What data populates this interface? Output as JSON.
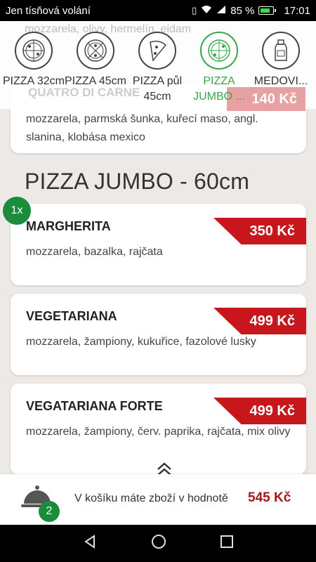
{
  "status_bar": {
    "carrier": "Jen tísňová volání",
    "battery": "85 %",
    "time": "17:01"
  },
  "categories": [
    {
      "label": "PIZZA 32cm",
      "icon": "pizza-icon",
      "active": false
    },
    {
      "label": "PIZZA 45cm",
      "icon": "pizza-icon",
      "active": false
    },
    {
      "label": "PIZZA půl 45cm",
      "icon": "pizza-slice-icon",
      "active": false
    },
    {
      "label": "PIZZA JUMBO ...",
      "icon": "pizza-icon",
      "active": true
    },
    {
      "label": "MEDOVI...",
      "icon": "bottle-icon",
      "active": false
    }
  ],
  "ghost": {
    "top_desc": "mozzarela, olivy, hermelín, eidam",
    "title": "QUATRO DI CARNE",
    "price": "140 Kč"
  },
  "previous_item": {
    "desc": "mozzarela, parmská šunka, kuřecí maso, angl. slanina, klobása mexico"
  },
  "section": {
    "title": "PIZZA JUMBO - 60cm"
  },
  "items": [
    {
      "name": "MARGHERITA",
      "desc": "mozzarela, bazalka, rajčata",
      "price": "350 Kč",
      "qty": "1x"
    },
    {
      "name": "VEGETARIANA",
      "desc": "mozzarela, žampiony, kukuřice, fazolové lusky",
      "price": "499 Kč"
    },
    {
      "name": "VEGATARIANA FORTE",
      "desc": "mozzarela, žampiony, červ. paprika, rajčata, mix olivy",
      "price": "499 Kč"
    }
  ],
  "cart": {
    "count": "2",
    "text": "V košíku máte zboží v hodnotě",
    "total": "545 Kč"
  },
  "colors": {
    "accent_green": "#36a74a",
    "badge_green": "#1a8c3c",
    "price_red": "#c8161d",
    "total_red": "#a5171e"
  }
}
